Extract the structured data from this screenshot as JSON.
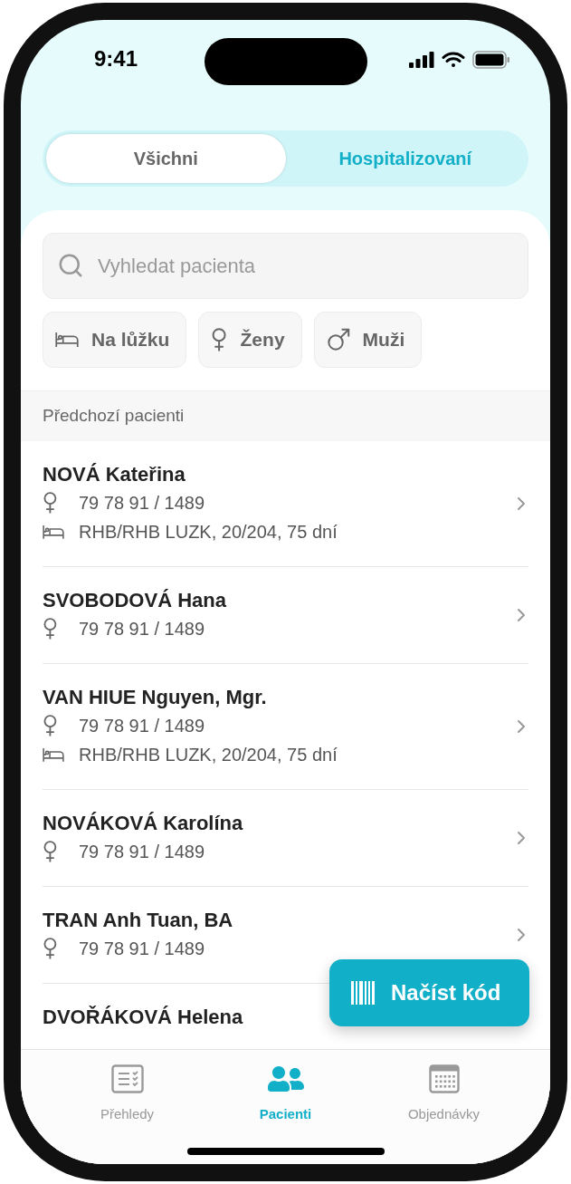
{
  "status_bar": {
    "time": "9:41"
  },
  "segments": [
    {
      "label": "Všichni",
      "selected": true
    },
    {
      "label": "Hospitalizovaní",
      "selected": false
    }
  ],
  "search": {
    "placeholder": "Vyhledat pacienta"
  },
  "filters": [
    {
      "kind": "bed",
      "label": "Na lůžku"
    },
    {
      "kind": "female",
      "label": "Ženy"
    },
    {
      "kind": "male",
      "label": "Muži"
    }
  ],
  "section_title": "Předchozí pacienti",
  "patients": [
    {
      "name": "NOVÁ Kateřina",
      "lines": [
        {
          "kind": "female",
          "text": "79 78 91 / 1489"
        },
        {
          "kind": "bed",
          "text": "RHB/RHB LUZK, 20/204, 75 dní"
        }
      ]
    },
    {
      "name": "SVOBODOVÁ Hana",
      "lines": [
        {
          "kind": "female",
          "text": "79 78 91 / 1489"
        }
      ]
    },
    {
      "name": "VAN HIUE Nguyen, Mgr.",
      "lines": [
        {
          "kind": "female",
          "text": "79 78 91 / 1489"
        },
        {
          "kind": "bed",
          "text": "RHB/RHB LUZK, 20/204, 75 dní"
        }
      ]
    },
    {
      "name": "NOVÁKOVÁ Karolína",
      "lines": [
        {
          "kind": "female",
          "text": "79 78 91 / 1489"
        }
      ]
    },
    {
      "name": "TRAN Anh Tuan, BA",
      "lines": [
        {
          "kind": "female",
          "text": "79 78 91 / 1489"
        }
      ]
    },
    {
      "name": "DVOŘÁKOVÁ Helena"
    }
  ],
  "scan_button": {
    "label": "Načíst kód"
  },
  "nav": [
    {
      "kind": "reports",
      "label": "Přehledy",
      "selected": false
    },
    {
      "kind": "patients",
      "label": "Pacienti",
      "selected": true
    },
    {
      "kind": "orders",
      "label": "Objednávky",
      "selected": false
    }
  ]
}
